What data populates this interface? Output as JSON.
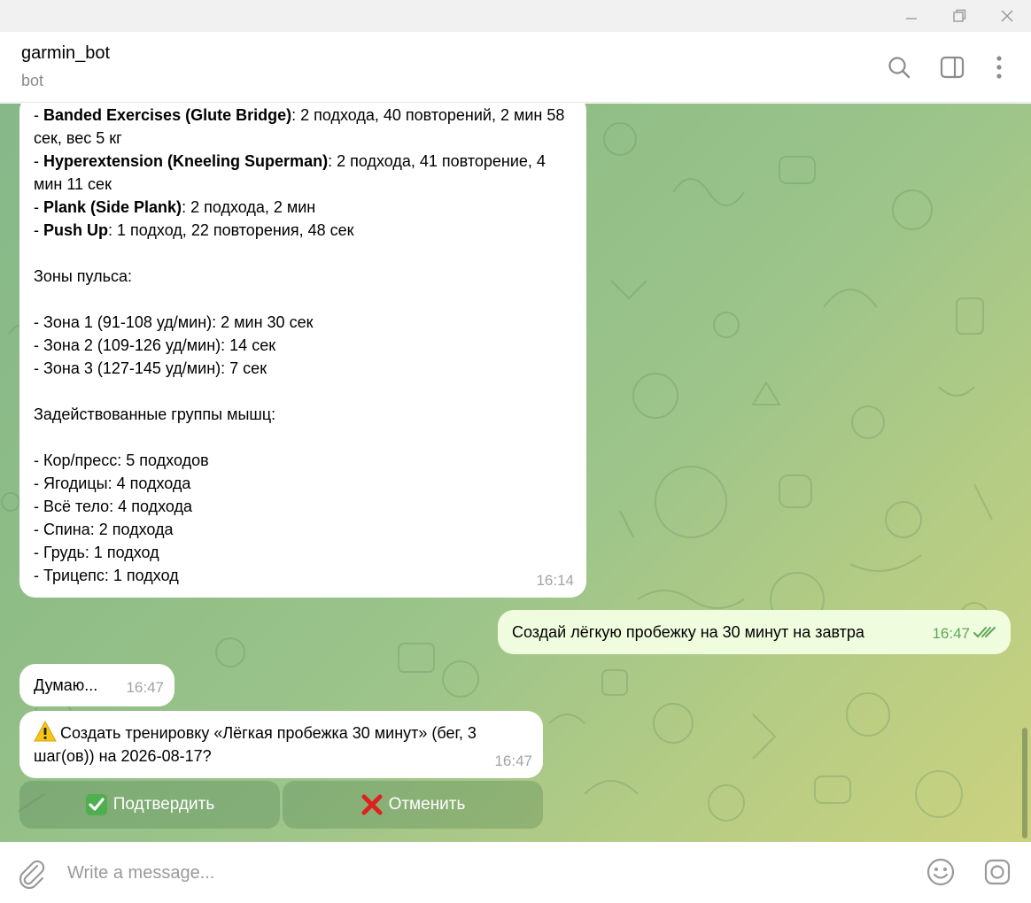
{
  "window": {
    "minimize_icon": "minimize-icon",
    "restore_icon": "restore-icon",
    "close_icon": "close-icon"
  },
  "header": {
    "title": "garmin_bot",
    "subtitle": "bot",
    "icons": [
      "search-icon",
      "sidebar-toggle-icon",
      "more-vertical-icon"
    ]
  },
  "messages": {
    "workout_summary": {
      "exercises": [
        {
          "prefix": "- ",
          "name": "Banded Exercises (Glute Bridge)",
          "detail": ": 2 подхода, 40 повторений, 2 мин 58 сек, вес 5 кг"
        },
        {
          "prefix": "- ",
          "name": "Hyperextension (Kneeling Superman)",
          "detail": ": 2 подхода, 41 повторение, 4 мин 11 сек"
        },
        {
          "prefix": "- ",
          "name": "Plank (Side Plank)",
          "detail": ": 2 подхода, 2 мин"
        },
        {
          "prefix": "- ",
          "name": "Push Up",
          "detail": ": 1 подход, 22 повторения, 48 сек"
        }
      ],
      "hr_heading": "Зоны пульса:",
      "hr_zones": [
        "- Зона 1 (91-108 уд/мин): 2 мин 30 сек",
        "- Зона 2 (109-126 уд/мин): 14 сек",
        "- Зона 3 (127-145 уд/мин): 7 сек"
      ],
      "muscles_heading": "Задействованные группы мышц:",
      "muscles": [
        "- Кор/пресс: 5 подходов",
        "- Ягодицы: 4 подхода",
        "- Всё тело: 4 подхода",
        "- Спина: 2 подхода",
        "- Грудь: 1 подход",
        "- Трицепс: 1 подход"
      ],
      "time": "16:14"
    },
    "outgoing": {
      "text": "Создай лёгкую пробежку на 30 минут на завтра",
      "time": "16:47",
      "status_icon": "double-check-icon"
    },
    "thinking": {
      "text": "Думаю...",
      "time": "16:47"
    },
    "confirm": {
      "icon": "warning-icon",
      "text": "Создать тренировку «Лёгкая пробежка 30 минут» (бег, 3 шаг(ов)) на 2026-08-17?",
      "time": "16:47"
    }
  },
  "inline_keyboard": {
    "confirm": {
      "icon": "check-mark-button-icon",
      "label": "Подтвердить"
    },
    "cancel": {
      "icon": "cross-mark-icon",
      "label": "Отменить"
    }
  },
  "composer": {
    "placeholder": "Write a message...",
    "icons": [
      "paperclip-icon",
      "emoji-icon",
      "camera-icon"
    ]
  },
  "colors": {
    "outgoing_bubble": "#effdde",
    "incoming_bubble": "#ffffff",
    "outgoing_time": "#5da659",
    "accent_green": "#4fae4e"
  }
}
